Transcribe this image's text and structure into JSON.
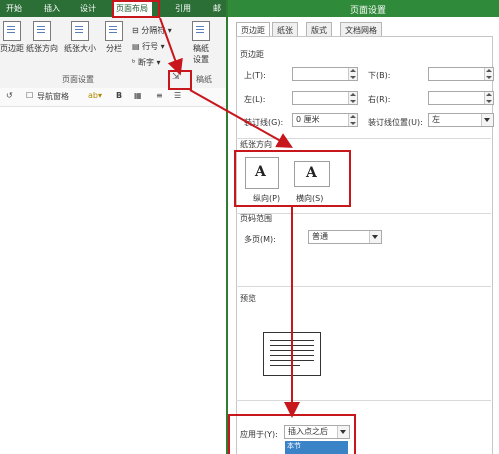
{
  "ribbon": {
    "tabs": [
      "开始",
      "插入",
      "设计",
      "页面布局",
      "引用",
      "邮"
    ],
    "active_tab": "页面布局",
    "buttons": {
      "margins": "页边距",
      "orientation": "纸张方向",
      "size": "纸张大小",
      "columns": "分栏",
      "breaks": "分隔符",
      "line_numbers": "行号",
      "hyphenation": "断字",
      "draft_paper_1": "稿纸",
      "draft_paper_2": "设置"
    },
    "groups": {
      "page_setup": "页面设置",
      "draft": "稿纸"
    },
    "toolbar2": {
      "nav_pane": "导航窗格",
      "bold": "B"
    }
  },
  "dialog": {
    "title": "页面设置",
    "tabs": [
      "页边距",
      "纸张",
      "版式",
      "文档网格"
    ],
    "margins_section": "页边距",
    "top_label": "上(T):",
    "bottom_label": "下(B):",
    "left_label": "左(L):",
    "right_label": "右(R):",
    "gutter_label": "装订线(G):",
    "gutter_value": "0 厘米",
    "gutter_pos_label": "装订线位置(U):",
    "gutter_pos_value": "左",
    "orientation_section": "纸张方向",
    "portrait": "纵向(P)",
    "landscape": "横向(S)",
    "pages_section": "页码范围",
    "multiple_pages_label": "多页(M):",
    "multiple_pages_value": "普通",
    "preview_section": "预览",
    "apply_to_label": "应用于(Y):",
    "apply_to_value": "插入点之后",
    "dropdown_option": "本节"
  },
  "colors": {
    "ribbon_green": "#2b6f37",
    "highlight_red": "#c8161d",
    "selection_blue": "#3b83c7"
  }
}
